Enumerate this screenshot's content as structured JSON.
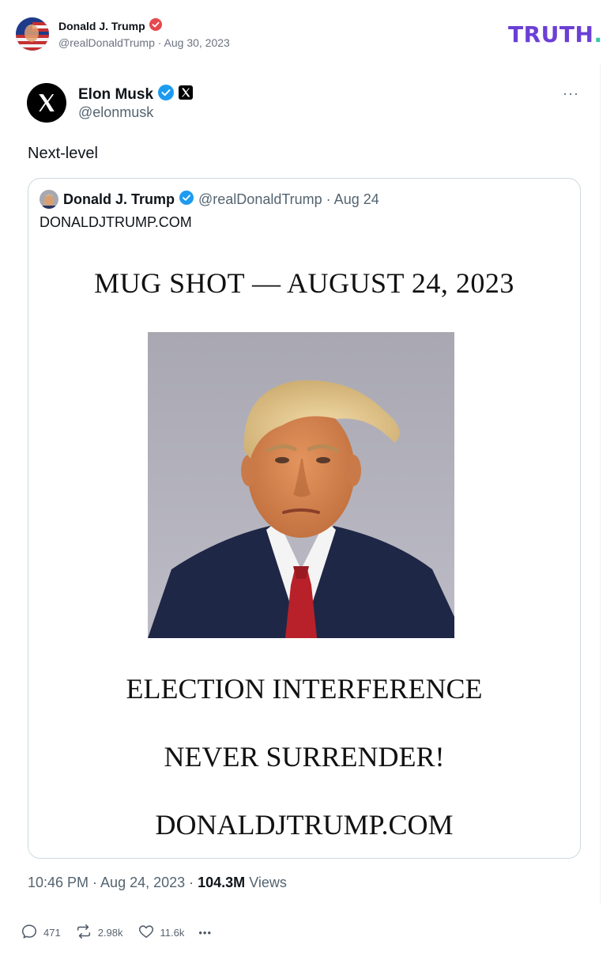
{
  "post": {
    "author_name": "Donald J. Trump",
    "author_handle": "@realDonaldTrump",
    "date": "Aug 30, 2023",
    "handle_line": "@realDonaldTrump · Aug 30, 2023",
    "verified_color": "#e5484d",
    "logo_main": "TRUTH",
    "logo_dot": ".",
    "logo_color": "#6b3fd6",
    "logo_dot_color": "#3ac4a9"
  },
  "tweet": {
    "name": "Elon Musk",
    "handle": "@elonmusk",
    "more": "···",
    "text": "Next-level",
    "time_prefix": "10:46 PM · Aug 24, 2023 · ",
    "views_count": "104.3M",
    "views_label": " Views",
    "verified_color": "#1d9bf0"
  },
  "quoted": {
    "name": "Donald J. Trump",
    "meta": "@realDonaldTrump · Aug 24",
    "text": "DONALDJTRUMP.COM"
  },
  "image_text": {
    "headline": "MUG SHOT — AUGUST 24, 2023",
    "line1": "ELECTION INTERFERENCE",
    "line2": "NEVER SURRENDER!",
    "line3": "DONALDJTRUMP.COM"
  },
  "actions": {
    "replies": "471",
    "reposts": "2.98k",
    "likes": "11.6k",
    "more": "•••"
  },
  "icons": [
    "avatar",
    "verified-badge-icon",
    "x-logo-icon",
    "more-icon",
    "reply-icon",
    "repost-icon",
    "heart-icon",
    "ellipsis-icon"
  ]
}
